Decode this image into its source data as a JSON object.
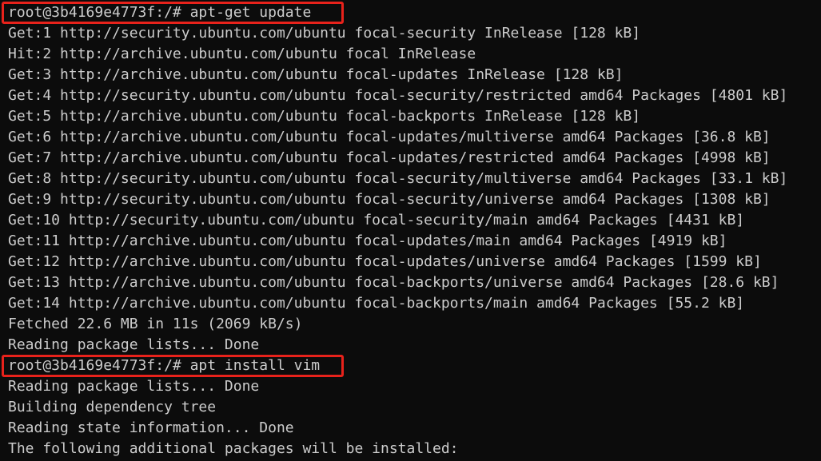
{
  "terminal": {
    "lines": [
      {
        "text": "root@3b4169e4773f:/# apt-get update",
        "highlighted": true
      },
      {
        "text": "Get:1 http://security.ubuntu.com/ubuntu focal-security InRelease [128 kB]"
      },
      {
        "text": "Hit:2 http://archive.ubuntu.com/ubuntu focal InRelease"
      },
      {
        "text": "Get:3 http://archive.ubuntu.com/ubuntu focal-updates InRelease [128 kB]"
      },
      {
        "text": "Get:4 http://security.ubuntu.com/ubuntu focal-security/restricted amd64 Packages [4801 kB]"
      },
      {
        "text": "Get:5 http://archive.ubuntu.com/ubuntu focal-backports InRelease [128 kB]"
      },
      {
        "text": "Get:6 http://archive.ubuntu.com/ubuntu focal-updates/multiverse amd64 Packages [36.8 kB]"
      },
      {
        "text": "Get:7 http://archive.ubuntu.com/ubuntu focal-updates/restricted amd64 Packages [4998 kB]"
      },
      {
        "text": "Get:8 http://security.ubuntu.com/ubuntu focal-security/multiverse amd64 Packages [33.1 kB]"
      },
      {
        "text": "Get:9 http://security.ubuntu.com/ubuntu focal-security/universe amd64 Packages [1308 kB]"
      },
      {
        "text": "Get:10 http://security.ubuntu.com/ubuntu focal-security/main amd64 Packages [4431 kB]"
      },
      {
        "text": "Get:11 http://archive.ubuntu.com/ubuntu focal-updates/main amd64 Packages [4919 kB]"
      },
      {
        "text": "Get:12 http://archive.ubuntu.com/ubuntu focal-updates/universe amd64 Packages [1599 kB]"
      },
      {
        "text": "Get:13 http://archive.ubuntu.com/ubuntu focal-backports/universe amd64 Packages [28.6 kB]"
      },
      {
        "text": "Get:14 http://archive.ubuntu.com/ubuntu focal-backports/main amd64 Packages [55.2 kB]"
      },
      {
        "text": "Fetched 22.6 MB in 11s (2069 kB/s)"
      },
      {
        "text": "Reading package lists... Done"
      },
      {
        "text": "root@3b4169e4773f:/# apt install vim",
        "highlighted": true
      },
      {
        "text": "Reading package lists... Done"
      },
      {
        "text": "Building dependency tree"
      },
      {
        "text": "Reading state information... Done"
      },
      {
        "text": "The following additional packages will be installed:"
      }
    ]
  },
  "colors": {
    "background": "#0c0c0c",
    "foreground": "#cccccc",
    "highlight_box": "#e8221b"
  }
}
